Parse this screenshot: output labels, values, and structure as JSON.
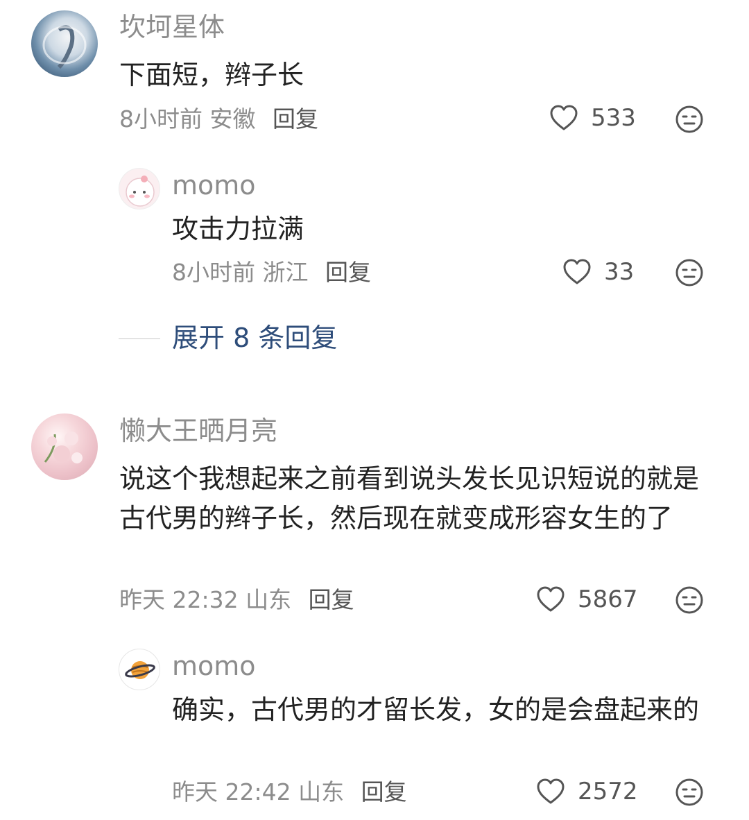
{
  "comments": [
    {
      "username": "坎坷星体",
      "text": "下面短，辫子长",
      "time": "8小时前",
      "location": "安徽",
      "reply_label": "回复",
      "likes": "533",
      "replies": [
        {
          "username": "momo",
          "text": "攻击力拉满",
          "time": "8小时前",
          "location": "浙江",
          "reply_label": "回复",
          "likes": "33"
        }
      ],
      "expand_label": "展开 8 条回复"
    },
    {
      "username": "懒大王晒月亮",
      "text": "说这个我想起来之前看到说头发长见识短说的就是古代男的辫子长，然后现在就变成形容女生的了",
      "time": "昨天 22:32",
      "location": "山东",
      "reply_label": "回复",
      "likes": "5867",
      "replies": [
        {
          "username": "momo",
          "text": "确实，古代男的才留长发，女的是会盘起来的",
          "time": "昨天 22:42",
          "location": "山东",
          "reply_label": "回复",
          "likes": "2572"
        }
      ]
    }
  ],
  "colors": {
    "username": "#8c8c8c",
    "body_text": "#222222",
    "expand_link": "#2e4d7a",
    "icon": "#555555"
  },
  "icons": {
    "like": "heart-outline-icon",
    "dislike": "meh-face-icon"
  }
}
